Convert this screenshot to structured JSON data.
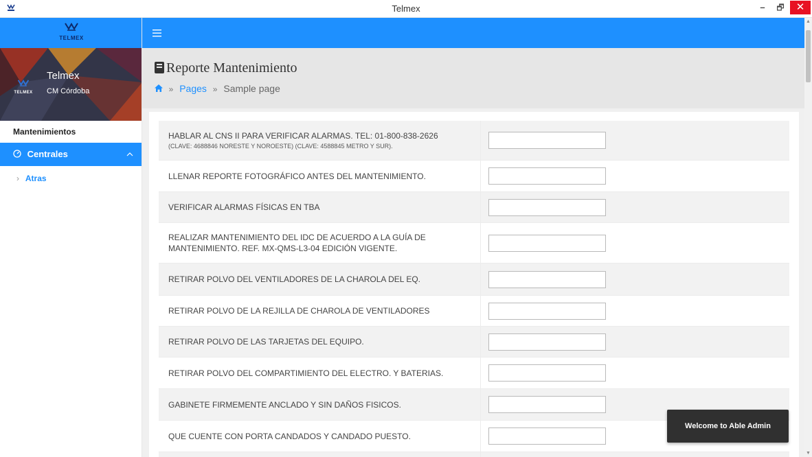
{
  "window": {
    "title": "Telmex",
    "minimize": "–",
    "maximize": "🗗",
    "close": "✕"
  },
  "sidebar": {
    "logo_text": "TELMEX",
    "profile": {
      "logo_text": "TELMEX",
      "name": "Telmex",
      "subtitle": "CM Córdoba"
    },
    "section_label": "Mantenimientos",
    "active_item": {
      "icon": "gauge-icon",
      "label": "Centrales"
    },
    "subitems": [
      {
        "label": "Atras"
      }
    ]
  },
  "topbar": {
    "menu_icon": "hamburger-icon"
  },
  "header": {
    "title": "Reporte Mantenimiento",
    "breadcrumb": {
      "home_icon": "home-icon",
      "separator": "»",
      "pages": "Pages",
      "current": "Sample page"
    }
  },
  "checklist": [
    {
      "text": "HABLAR AL CNS II PARA VERIFICAR ALARMAS. TEL: 01-800-838-2626",
      "subtext": "(CLAVE: 4688846 NORESTE Y NOROESTE) (CLAVE: 4588845 METRO Y SUR).",
      "value": ""
    },
    {
      "text": "LLENAR REPORTE FOTOGRÁFICO ANTES DEL MANTENIMIENTO.",
      "value": ""
    },
    {
      "text": "VERIFICAR ALARMAS FÍSICAS EN TBA",
      "value": ""
    },
    {
      "text": "REALIZAR MANTENIMIENTO DEL IDC DE ACUERDO A LA GUÍA DE",
      "text2": "MANTENIMIENTO. REF. MX-QMS-L3-04 EDICIÓN VIGENTE.",
      "value": ""
    },
    {
      "text": "RETIRAR POLVO DEL VENTILADORES DE LA CHAROLA DEL EQ.",
      "value": ""
    },
    {
      "text": "RETIRAR POLVO DE LA REJILLA DE CHAROLA DE VENTILADORES",
      "value": ""
    },
    {
      "text": "RETIRAR POLVO DE LAS TARJETAS DEL EQUIPO.",
      "value": ""
    },
    {
      "text": "RETIRAR POLVO DEL COMPARTIMIENTO DEL ELECTRO. Y BATERIAS.",
      "value": ""
    },
    {
      "text": "GABINETE FIRMEMENTE ANCLADO Y SIN DAÑOS FISICOS.",
      "value": ""
    },
    {
      "text": "QUE CUENTE CON PORTA CANDADOS Y CANDADO PUESTO.",
      "value": ""
    }
  ],
  "toast": {
    "message": "Welcome to Able Admin"
  },
  "colors": {
    "primary": "#1e90ff",
    "header_bg": "#e6e6e6",
    "toast_bg": "#303030",
    "close_red": "#e81123"
  }
}
